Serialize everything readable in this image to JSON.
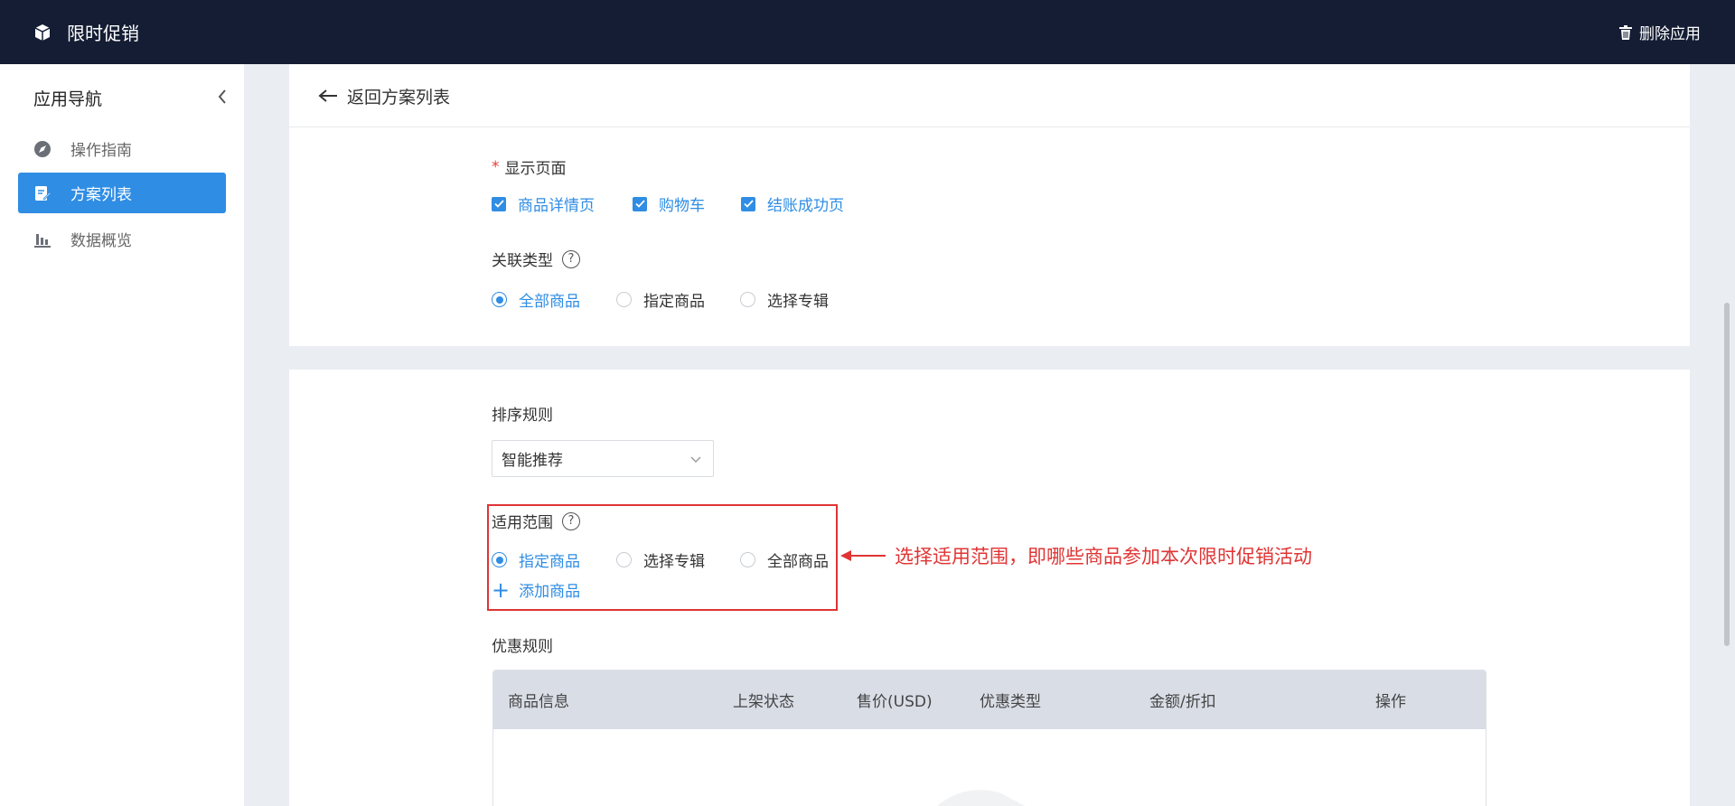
{
  "app": {
    "title": "限时促销",
    "delete_label": "删除应用"
  },
  "sidebar": {
    "heading": "应用导航",
    "items": [
      {
        "label": "操作指南",
        "icon": "compass-icon"
      },
      {
        "label": "方案列表",
        "icon": "document-edit-icon",
        "active": true
      },
      {
        "label": "数据概览",
        "icon": "bar-chart-icon"
      }
    ]
  },
  "header": {
    "back_label": "返回方案列表"
  },
  "display_page": {
    "label": "显示页面",
    "required_mark": "*",
    "options": [
      {
        "label": "商品详情页",
        "checked": true
      },
      {
        "label": "购物车",
        "checked": true
      },
      {
        "label": "结账成功页",
        "checked": true
      }
    ]
  },
  "association_type": {
    "label": "关联类型",
    "help": "?",
    "options": [
      {
        "label": "全部商品",
        "selected": true
      },
      {
        "label": "指定商品",
        "selected": false
      },
      {
        "label": "选择专辑",
        "selected": false
      }
    ]
  },
  "sort_rule": {
    "label": "排序规则",
    "value": "智能推荐"
  },
  "scope": {
    "label": "适用范围",
    "help": "?",
    "options": [
      {
        "label": "指定商品",
        "selected": true
      },
      {
        "label": "选择专辑",
        "selected": false
      },
      {
        "label": "全部商品",
        "selected": false
      }
    ],
    "add_label": "添加商品"
  },
  "annotation": {
    "text": "选择适用范围，即哪些商品参加本次限时促销活动"
  },
  "discount_rule": {
    "label": "优惠规则",
    "columns": [
      "商品信息",
      "上架状态",
      "售价(USD)",
      "优惠类型",
      "金额/折扣",
      "操作"
    ]
  },
  "colors": {
    "topbar": "#141d33",
    "accent": "#2f8de4",
    "annotation": "#e03434"
  }
}
